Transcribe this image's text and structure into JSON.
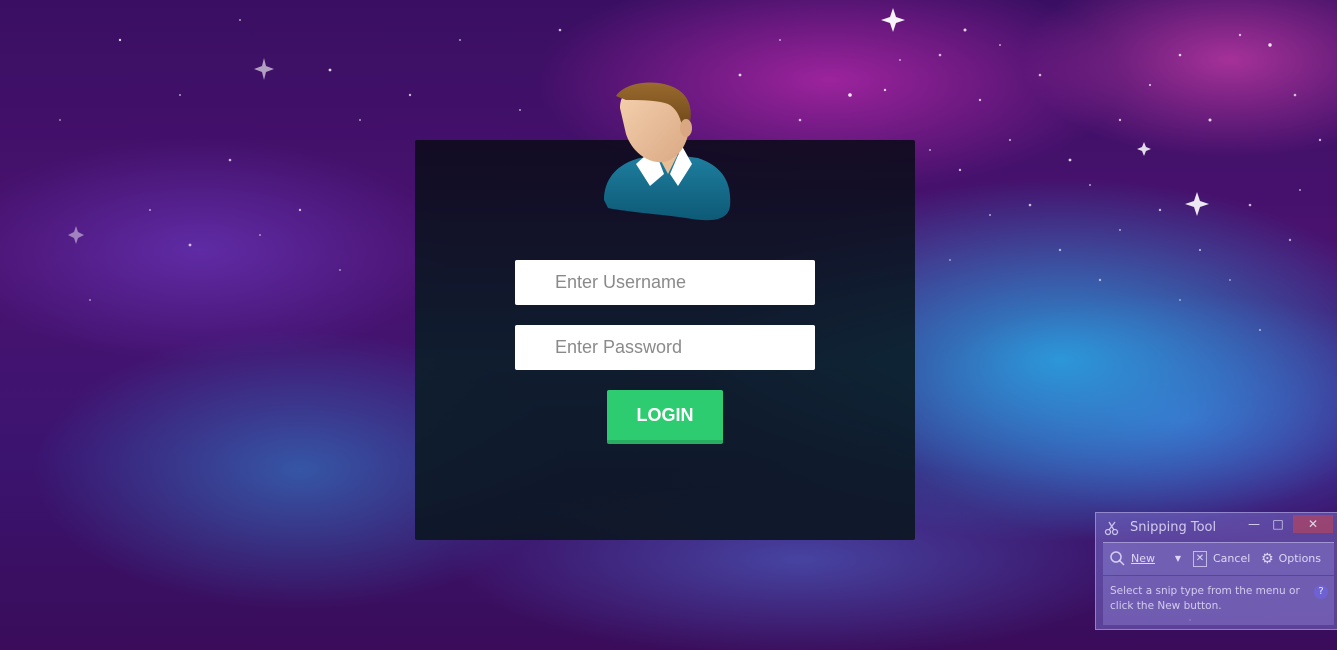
{
  "login": {
    "username_placeholder": "Enter Username",
    "password_placeholder": "Enter Password",
    "login_label": "LOGIN",
    "button_color": "#2ecc71"
  },
  "avatar": {
    "icon": "user-avatar-icon"
  },
  "snipping_tool": {
    "title": "Snipping Tool",
    "new_label": "New",
    "cancel_label": "Cancel",
    "options_label": "Options",
    "instructions": "Select a snip type from the menu or click the New button.",
    "help_symbol": "?"
  }
}
